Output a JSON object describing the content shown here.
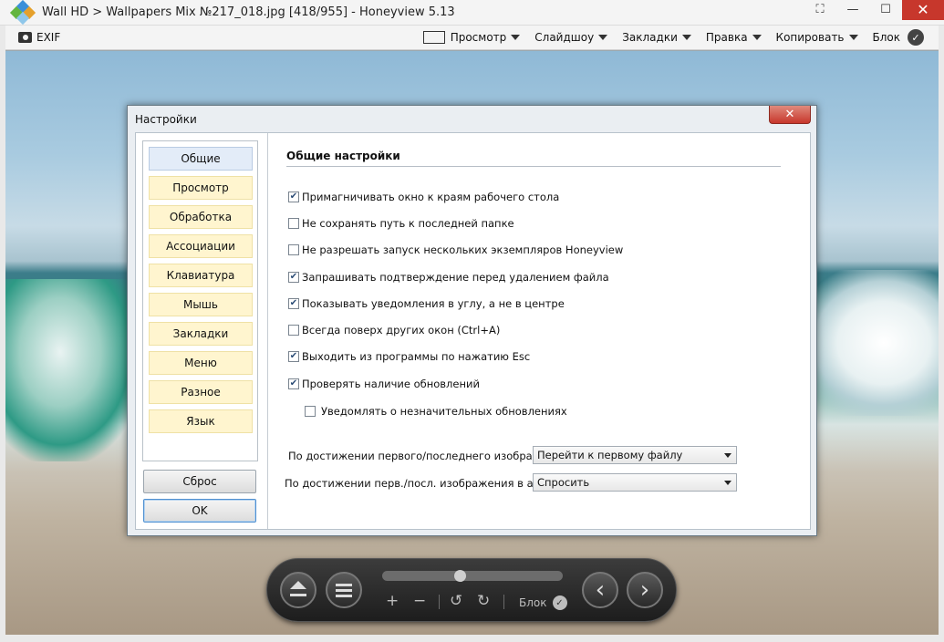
{
  "window": {
    "title": "Wall HD > Wallpapers Mix №217_018.jpg [418/955] - Honeyview 5.13",
    "minimize": "—",
    "maximize": "☐",
    "close": "✕",
    "fullscreen": "⛶"
  },
  "menubar": {
    "exif": "EXIF",
    "items": [
      {
        "label": "Просмотр",
        "icon": "view-icon"
      },
      {
        "label": "Слайдшоу"
      },
      {
        "label": "Закладки"
      },
      {
        "label": "Правка"
      },
      {
        "label": "Копировать"
      }
    ],
    "lock": "Блок"
  },
  "dialog": {
    "title": "Настройки",
    "close": "✕",
    "nav": [
      "Общие",
      "Просмотр",
      "Обработка",
      "Ассоциации",
      "Клавиатура",
      "Мышь",
      "Закладки",
      "Меню",
      "Разное",
      "Язык"
    ],
    "active_index": 0,
    "reset_label": "Сброс",
    "ok_label": "OK",
    "section_title": "Общие настройки",
    "options": [
      {
        "label": "Примагничивать окно к краям рабочего стола",
        "checked": true
      },
      {
        "label": "Не сохранять путь к последней папке",
        "checked": false
      },
      {
        "label": "Не разрешать запуск нескольких экземпляров Honeyview",
        "checked": false
      },
      {
        "label": "Запрашивать подтверждение перед удалением файла",
        "checked": true
      },
      {
        "label": "Показывать уведомления в углу, а не в центре",
        "checked": true
      },
      {
        "label": "Всегда поверх других окон (Ctrl+A)",
        "checked": false
      },
      {
        "label": "Выходить из программы по нажатию Esc",
        "checked": true
      },
      {
        "label": "Проверять наличие обновлений",
        "checked": true
      },
      {
        "label": "Уведомлять о незначительных обновлениях",
        "checked": false,
        "indent": true
      }
    ],
    "selects": [
      {
        "label": "По достижении первого/последнего изображения:",
        "value": "Перейти к первому файлу"
      },
      {
        "label": "По достижении перв./посл. изображения в архиве:",
        "value": "Спросить"
      }
    ]
  },
  "toolbar": {
    "plus": "+",
    "minus": "−",
    "rotate_left": "↺",
    "rotate_right": "↻",
    "lock": "Блок",
    "prev": "‹",
    "next": "›",
    "check": "✓"
  }
}
